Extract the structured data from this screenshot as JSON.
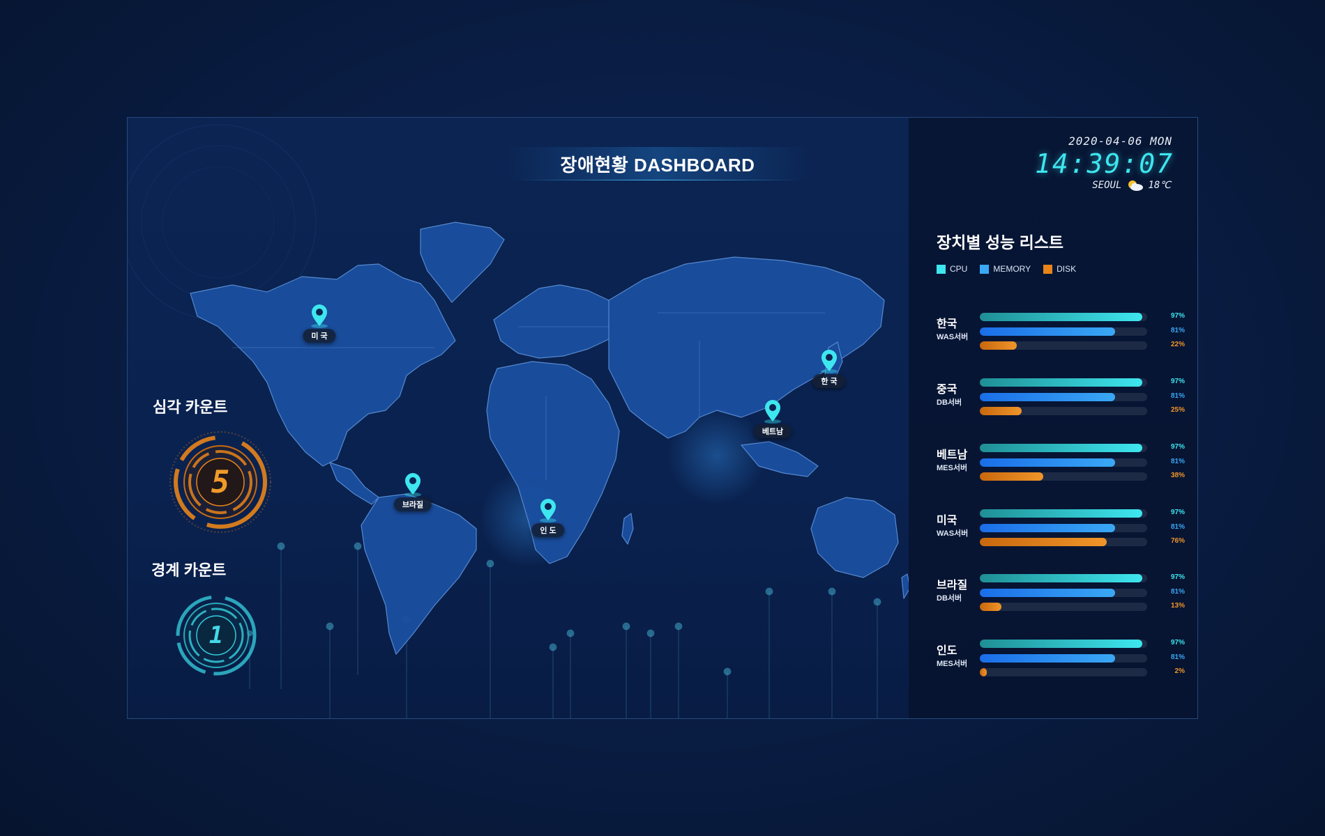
{
  "title": "장애현황 DASHBOARD",
  "clock": {
    "date": "2020-04-06 MON",
    "time": "14:39:07",
    "city": "SEOUL",
    "temperature": "18℃",
    "weather_icon": "partly-cloudy-icon"
  },
  "counts": {
    "critical": {
      "label": "심각 카운트",
      "value": "5",
      "color": "#e8841a"
    },
    "warning": {
      "label": "경계 카운트",
      "value": "1",
      "color": "#35c8d8"
    }
  },
  "map_pins": [
    {
      "label": "미 국"
    },
    {
      "label": "한 국"
    },
    {
      "label": "베트남"
    },
    {
      "label": "브라질"
    },
    {
      "label": "인 도"
    }
  ],
  "performance": {
    "title": "장치별 성능 리스트",
    "legend": [
      {
        "label": "CPU",
        "color": "#3ee6ef"
      },
      {
        "label": "MEMORY",
        "color": "#3aa8f5"
      },
      {
        "label": "DISK",
        "color": "#e8841a"
      }
    ],
    "devices": [
      {
        "name": "한국",
        "type": "WAS서버",
        "cpu": 97,
        "memory": 81,
        "disk": 22,
        "cpu_label": "97%",
        "memory_label": "81%",
        "disk_label": "22%"
      },
      {
        "name": "중국",
        "type": "DB서버",
        "cpu": 97,
        "memory": 81,
        "disk": 25,
        "cpu_label": "97%",
        "memory_label": "81%",
        "disk_label": "25%"
      },
      {
        "name": "베트남",
        "type": "MES서버",
        "cpu": 97,
        "memory": 81,
        "disk": 38,
        "cpu_label": "97%",
        "memory_label": "81%",
        "disk_label": "38%"
      },
      {
        "name": "미국",
        "type": "WAS서버",
        "cpu": 97,
        "memory": 81,
        "disk": 76,
        "cpu_label": "97%",
        "memory_label": "81%",
        "disk_label": "76%"
      },
      {
        "name": "브라질",
        "type": "DB서버",
        "cpu": 97,
        "memory": 81,
        "disk": 13,
        "cpu_label": "97%",
        "memory_label": "81%",
        "disk_label": "13%"
      },
      {
        "name": "인도",
        "type": "MES서버",
        "cpu": 97,
        "memory": 81,
        "disk": 2,
        "cpu_label": "97%",
        "memory_label": "81%",
        "disk_label": "2%"
      }
    ]
  }
}
